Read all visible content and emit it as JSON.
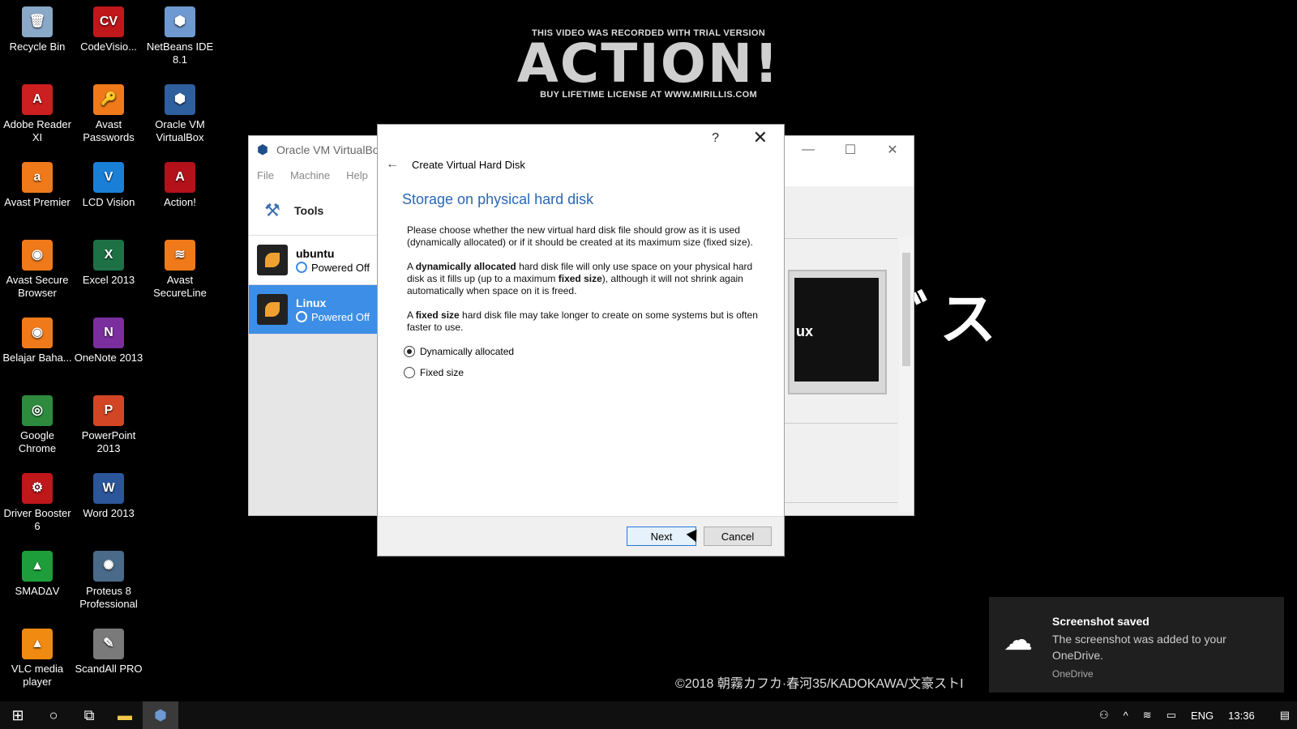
{
  "desktop": {
    "icons": [
      {
        "label": "Recycle Bin",
        "color": "#8aa8c8",
        "glyph": "🗑"
      },
      {
        "label": "CodeVisio...",
        "color": "#c0171b",
        "glyph": "CV"
      },
      {
        "label": "NetBeans IDE 8.1",
        "color": "#6e9ad1",
        "glyph": "⬢"
      },
      {
        "label": "Adobe Reader XI",
        "color": "#cc1f1f",
        "glyph": "A"
      },
      {
        "label": "Avast Passwords",
        "color": "#f07a1a",
        "glyph": "🔑"
      },
      {
        "label": "Oracle VM VirtualBox",
        "color": "#2e5f9e",
        "glyph": "⬢"
      },
      {
        "label": "Avast Premier",
        "color": "#f07a1a",
        "glyph": "a"
      },
      {
        "label": "LCD Vision",
        "color": "#1a7fd6",
        "glyph": "V"
      },
      {
        "label": "Action!",
        "color": "#b3121b",
        "glyph": "A"
      },
      {
        "label": "Avast Secure Browser",
        "color": "#f07a1a",
        "glyph": "◉"
      },
      {
        "label": "Excel 2013",
        "color": "#1e7145",
        "glyph": "X"
      },
      {
        "label": "Avast SecureLine",
        "color": "#f07a1a",
        "glyph": "≋"
      },
      {
        "label": "Belajar Baha...",
        "color": "#f07a1a",
        "glyph": "◉"
      },
      {
        "label": "OneNote 2013",
        "color": "#7b2f9f",
        "glyph": "N"
      },
      {
        "label": "Google Chrome",
        "color": "#2e8b3e",
        "glyph": "◎"
      },
      {
        "label": "PowerPoint 2013",
        "color": "#d24625",
        "glyph": "P"
      },
      {
        "label": "Driver Booster 6",
        "color": "#c0171b",
        "glyph": "⚙"
      },
      {
        "label": "Word 2013",
        "color": "#2b579a",
        "glyph": "W"
      },
      {
        "label": "SMADΔV",
        "color": "#1e9e3a",
        "glyph": "▲"
      },
      {
        "label": "Proteus 8 Professional",
        "color": "#4a6a8a",
        "glyph": "✺"
      },
      {
        "label": "VLC media player",
        "color": "#f08a10",
        "glyph": "▲"
      },
      {
        "label": "ScandAll PRO",
        "color": "#7a7a7a",
        "glyph": "✎"
      }
    ]
  },
  "watermark": {
    "top": "THIS VIDEO WAS RECORDED WITH TRIAL VERSION",
    "logo": "ACTION!",
    "bottom": "BUY LIFETIME LICENSE AT WWW.MIRILLIS.COM"
  },
  "vbox": {
    "title": "Oracle VM VirtualBo",
    "menu": [
      "File",
      "Machine",
      "Help"
    ],
    "tools_label": "Tools",
    "vms": [
      {
        "name": "ubuntu",
        "state": "Powered Off"
      },
      {
        "name": "Linux",
        "state": "Powered Off"
      }
    ],
    "preview_text": "ux"
  },
  "dialog": {
    "help": "?",
    "close": "✕",
    "back": "←",
    "header": "Create Virtual Hard Disk",
    "title": "Storage on physical hard disk",
    "p1": "Please choose whether the new virtual hard disk file should grow as it is used (dynamically allocated) or if it should be created at its maximum size (fixed size).",
    "p2_a": "A ",
    "p2_b": "dynamically allocated",
    "p2_c": " hard disk file will only use space on your physical hard disk as it fills up (up to a maximum ",
    "p2_d": "fixed size",
    "p2_e": "), although it will not shrink again automatically when space on it is freed.",
    "p3_a": "A ",
    "p3_b": "fixed size",
    "p3_c": " hard disk file may take longer to create on some systems but is often faster to use.",
    "opt_dynamic": "Dynamically allocated",
    "opt_fixed": "Fixed size",
    "next": "Next",
    "cancel": "Cancel"
  },
  "overlay": {
    "katakana": "ﾞス",
    "copyright": "©2018 朝霧カフカ·春河35/KADOKAWA/文豪ストI"
  },
  "toast": {
    "title": "Screenshot saved",
    "body": "The screenshot was added to your OneDrive.",
    "source": "OneDrive"
  },
  "taskbar": {
    "lang": "ENG",
    "time": "13:36"
  }
}
